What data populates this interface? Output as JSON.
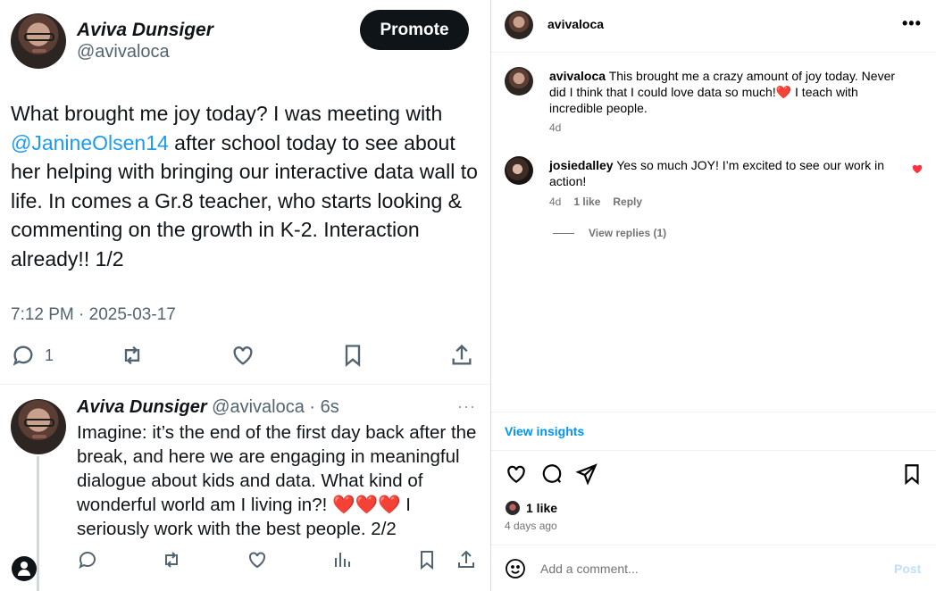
{
  "tweet": {
    "author_name": "Aviva Dunsiger",
    "author_handle": "@avivaloca",
    "promote_label": "Promote",
    "text_before": "What brought me joy today? I was meeting with ",
    "mention": "@JanineOlsen14",
    "text_after": " after school today to see about her helping with bringing our interactive data wall to life. In comes a Gr.8 teacher, who starts looking & commenting on the growth in K-2. Interaction already!! 1/2",
    "timestamp": "7:12 PM · 2025-03-17",
    "reply_count": "1",
    "icons": [
      "reply-icon",
      "retweet-icon",
      "like-icon",
      "bookmark-icon",
      "share-icon"
    ]
  },
  "reply_tweet": {
    "author_name": "Aviva Dunsiger",
    "meta": " @avivaloca · 6s",
    "more": "···",
    "text": "Imagine: it’s the end of the first day back after the break, and here we are engaging in meaningful dialogue about kids and data. What kind of wonderful world am I living in?! ",
    "hearts": "❤️❤️❤️",
    "text_end": " I seriously work with the best people. 2/2",
    "icons": [
      "reply-icon",
      "retweet-icon",
      "like-icon",
      "views-icon",
      "bookmark-icon",
      "share-icon"
    ]
  },
  "instagram": {
    "header_username": "avivaloca",
    "more": "•••",
    "caption_user": "avivaloca",
    "caption_before": " This brought me a crazy amount of joy today. Never did I think that I could love data so much!",
    "caption_heart": "❤️",
    "caption_after": " I teach with incredible people.",
    "caption_time": "4d",
    "comment_user": "josiedalley",
    "comment_text": " Yes so much JOY! I’m excited to see our work in action!",
    "comment_time": "4d",
    "comment_likes": "1 like",
    "comment_reply": "Reply",
    "view_replies": "View replies (1)",
    "view_insights": "View insights",
    "likes": "1 like",
    "post_age": "4 days ago",
    "comment_placeholder": "Add a comment...",
    "post_label": "Post",
    "colors": {
      "link_blue": "#0095f6",
      "heart_red": "#ff3040",
      "post_disabled": "#c0dffd"
    }
  }
}
